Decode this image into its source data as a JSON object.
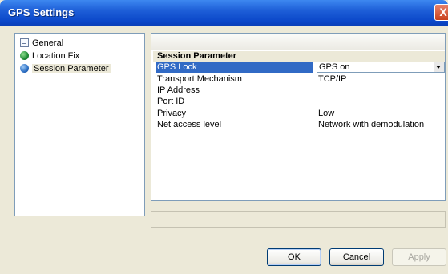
{
  "window": {
    "title": "GPS Settings",
    "close_glyph": "X"
  },
  "tree": {
    "items": [
      {
        "label": "General",
        "icon": "document-icon"
      },
      {
        "label": "Location Fix",
        "icon": "globe-green-icon"
      },
      {
        "label": "Session Parameter",
        "icon": "globe-blue-icon",
        "selected": true
      }
    ]
  },
  "grid": {
    "section_title": "Session Parameter",
    "rows": [
      {
        "key": "GPS Lock",
        "value": "GPS on",
        "selected": true,
        "editor": "dropdown"
      },
      {
        "key": "Transport Mechanism",
        "value": "TCP/IP"
      },
      {
        "key": "IP Address",
        "value": ""
      },
      {
        "key": "Port ID",
        "value": ""
      },
      {
        "key": "Privacy",
        "value": "Low"
      },
      {
        "key": "Net access level",
        "value": "Network with demodulation"
      }
    ]
  },
  "buttons": {
    "ok": "OK",
    "cancel": "Cancel",
    "apply": "Apply"
  },
  "colors": {
    "titlebar": "#0a46c8",
    "selection": "#316ac5",
    "close": "#c8411e"
  }
}
